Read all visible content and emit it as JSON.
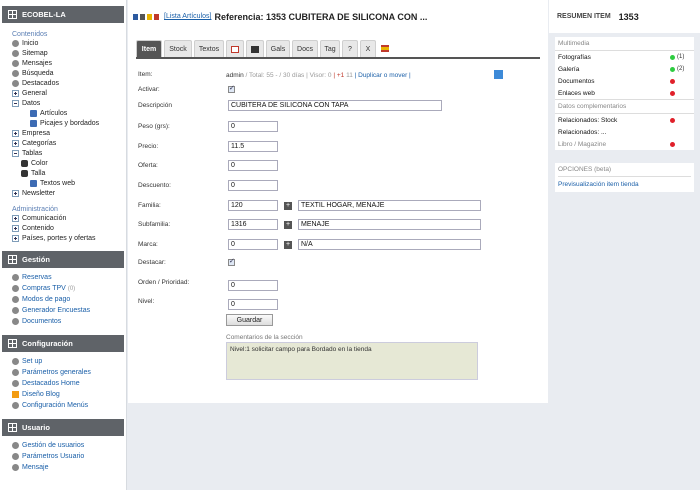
{
  "sidebar": {
    "header": "ECOBEL-LA",
    "contenidos_label": "Contenidos",
    "items": [
      {
        "label": "Inicio",
        "icon": "lightning-icon",
        "indent": 0
      },
      {
        "label": "Sitemap",
        "icon": "sitemap-icon",
        "indent": 0
      },
      {
        "label": "Mensajes",
        "icon": "messages-icon",
        "indent": 0
      },
      {
        "label": "Búsqueda",
        "icon": "search-icon",
        "indent": 0
      },
      {
        "label": "Destacados",
        "icon": "check-icon",
        "indent": 0
      },
      {
        "label": "General",
        "icon": "expand-icon",
        "indent": 0
      },
      {
        "label": "Datos",
        "icon": "collapse-icon",
        "indent": 0
      },
      {
        "label": "Artículos",
        "icon": "doc-icon",
        "indent": 2
      },
      {
        "label": "Picajes y bordados",
        "icon": "doc-icon",
        "indent": 2
      },
      {
        "label": "Empresa",
        "icon": "expand-icon",
        "indent": 0
      },
      {
        "label": "Categorías",
        "icon": "expand-icon",
        "indent": 0
      },
      {
        "label": "Tablas",
        "icon": "collapse-icon",
        "indent": 0
      },
      {
        "label": "Color",
        "icon": "database-icon",
        "indent": 1
      },
      {
        "label": "Talla",
        "icon": "database-icon",
        "indent": 1
      },
      {
        "label": "Textos web",
        "icon": "doc-icon",
        "indent": 2
      },
      {
        "label": "Newsletter",
        "icon": "expand-icon",
        "indent": 0
      }
    ],
    "admin_label": "Administración",
    "admin_items": [
      {
        "label": "Comunicación"
      },
      {
        "label": "Contenido"
      },
      {
        "label": "Países, portes y ofertas"
      }
    ],
    "gestion_header": "Gestión",
    "gestion_items": [
      {
        "label": "Reservas",
        "icon": "calendar-icon"
      },
      {
        "label": "Compras TPV",
        "extra": "(0)",
        "icon": "cart-icon"
      },
      {
        "label": "Modos de pago",
        "icon": "money-icon"
      },
      {
        "label": "Generador Encuestas",
        "icon": "survey-icon"
      },
      {
        "label": "Documentos",
        "icon": "documents-icon"
      }
    ],
    "config_header": "Configuración",
    "config_items": [
      {
        "label": "Set up",
        "icon": "wrench-icon"
      },
      {
        "label": "Parámetros generales",
        "icon": "params-icon"
      },
      {
        "label": "Destacados Home",
        "icon": "check-icon"
      },
      {
        "label": "Diseño Blog",
        "icon": "blog-icon"
      },
      {
        "label": "Configuración Menús",
        "icon": "menu-icon"
      }
    ],
    "usuario_header": "Usuario",
    "usuario_items": [
      {
        "label": "Gestión de usuarios",
        "icon": "users-icon"
      },
      {
        "label": "Parámetros Usuario",
        "icon": "user-params-icon"
      },
      {
        "label": "Mensaje",
        "icon": "message-icon"
      }
    ]
  },
  "header": {
    "list_link": "[Lista Artículos]",
    "title": "Referencia: 1353 CUBITERA DE SILICONA CON ..."
  },
  "tabs": [
    "Item",
    "Stock",
    "Textos",
    "",
    "",
    "Gals",
    "Docs",
    "Tag",
    "?",
    "X",
    ""
  ],
  "form": {
    "item_label": "Item:",
    "meta": {
      "user": "admin",
      "total": " / Total: 55 - ",
      "days": " / 30 días ",
      "visor": " | Visor: 0 ",
      "plus": " | +1 ",
      "eleven": " 11 ",
      "dup": "| Duplicar o mover |"
    },
    "activar_label": "Activar:",
    "descripcion_label": "Descripción",
    "descripcion_value": "CUBITERA DE SILICONA CON TAPA",
    "peso_label": "Peso (grs):",
    "peso_value": "0",
    "precio_label": "Precio:",
    "precio_value": "11.5",
    "oferta_label": "Oferta:",
    "oferta_value": "0",
    "descuento_label": "Descuento:",
    "descuento_value": "0",
    "familia_label": "Familia:",
    "familia_value": "120",
    "familia_name": "TEXTIL HOGAR, MENAJE",
    "subfamilia_label": "Subfamilia:",
    "subfamilia_value": "1316",
    "subfamilia_name": "MENAJE",
    "marca_label": "Marca:",
    "marca_value": "0",
    "marca_name": "N/A",
    "destacar_label": "Destacar:",
    "orden_label": "Orden / Prioridad:",
    "orden_value": "0",
    "nivel_label": "Nivel:",
    "nivel_value": "0",
    "save_label": "Guardar",
    "comments_label": "Comentarios de la sección",
    "comments_value": "Nivel:1 solicitar campo para Bordado en la tienda"
  },
  "right": {
    "title": "RESUMEN ITEM",
    "number": "1353",
    "multimedia_label": "Multimedia",
    "multimedia": [
      {
        "label": "Fotografías",
        "status": "green",
        "count": "(1)"
      },
      {
        "label": "Galería",
        "status": "green",
        "count": "(2)"
      },
      {
        "label": "Documentos",
        "status": "red",
        "count": ""
      },
      {
        "label": "Enlaces web",
        "status": "red",
        "count": ""
      }
    ],
    "datos_label": "Datos complementarios",
    "datos": [
      {
        "label": "Relacionados: Stock",
        "status": "red"
      },
      {
        "label": "Relacionados: ...",
        "status": ""
      },
      {
        "label": "Libro / Magazine",
        "status": "red"
      }
    ],
    "opciones_label": "OPCIONES (beta)",
    "preview_link": "Previsualización item tienda"
  },
  "colors": {
    "accent": "#1a5fa8",
    "tab_active": "#555555",
    "status_green": "#2ecc40",
    "status_red": "#e0202a"
  }
}
